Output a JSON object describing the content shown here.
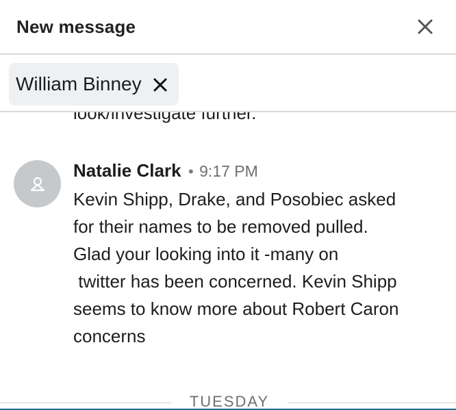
{
  "header": {
    "title": "New message",
    "close_icon": "close-icon"
  },
  "recipient": {
    "name": "William Binney",
    "remove_icon": "close-icon"
  },
  "thread": {
    "previous_fragment": "look/investigate further.",
    "message": {
      "sender": "Natalie Clark",
      "separator": "•",
      "time": "9:17 PM",
      "avatar_icon": "person-icon",
      "lines": [
        "Kevin Shipp, Drake, and Posobiec asked",
        "for their names to be removed pulled.",
        "Glad your looking into it -many on",
        " twitter has been concerned. Kevin Shipp",
        "seems to know more about Robert Caron",
        "concerns"
      ]
    },
    "day_separator": "TUESDAY"
  },
  "colors": {
    "chip_bg": "#eef1f4",
    "avatar_bg": "#c6c9cc",
    "divider": "#d9d9d9",
    "accent": "#1f6f8f"
  }
}
